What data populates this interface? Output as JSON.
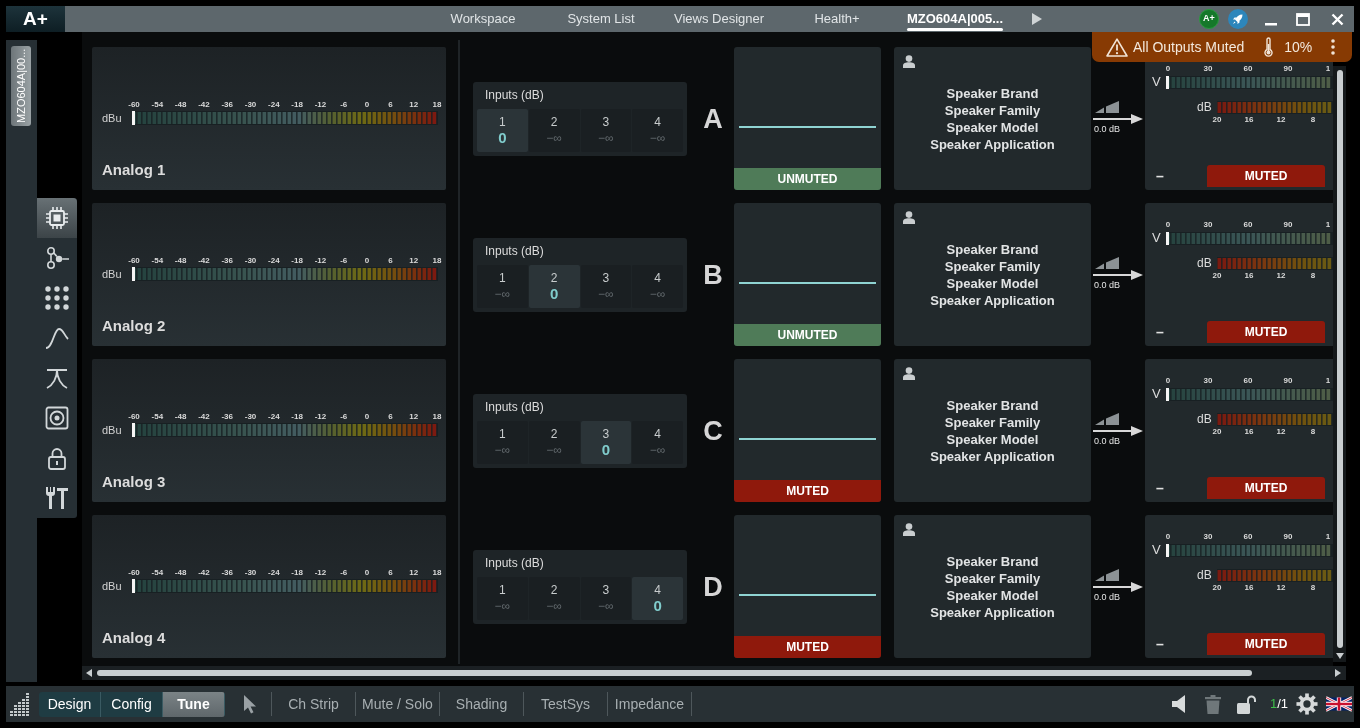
{
  "title_bar": {
    "logo": "A+",
    "tabs": [
      {
        "label": "Workspace",
        "selected": false
      },
      {
        "label": "System List",
        "selected": false
      },
      {
        "label": "Views Designer",
        "selected": false
      },
      {
        "label": "Health+",
        "selected": false
      },
      {
        "label": "MZO604A|005...",
        "selected": true
      }
    ],
    "badge": "A+"
  },
  "alert": {
    "message": "All Outputs Muted",
    "temperature": "10%"
  },
  "device_tab": "MZO604A|00...",
  "tool_rail": [
    {
      "kind": "chip",
      "selected": true
    },
    {
      "kind": "routing",
      "selected": false
    },
    {
      "kind": "matrix",
      "selected": false
    },
    {
      "kind": "filter",
      "selected": false
    },
    {
      "kind": "crossover",
      "selected": false
    },
    {
      "kind": "speaker",
      "selected": false
    },
    {
      "kind": "lock",
      "selected": false
    },
    {
      "kind": "tools",
      "selected": false
    }
  ],
  "channels": [
    {
      "input_name": "Analog 1",
      "meter": {
        "unit": "dBu",
        "scale": [
          "-60",
          "-54",
          "-48",
          "-42",
          "-36",
          "-30",
          "-24",
          "-18",
          "-12",
          "-6",
          "0",
          "6",
          "12",
          "18"
        ],
        "level": 0
      },
      "inputs_title": "Inputs (dB)",
      "inputs": [
        {
          "number": "1",
          "value": "0",
          "selected": true
        },
        {
          "number": "2",
          "value": "−∞",
          "selected": false
        },
        {
          "number": "3",
          "value": "−∞",
          "selected": false
        },
        {
          "number": "4",
          "value": "−∞",
          "selected": false
        }
      ],
      "letter": "A",
      "mute": {
        "label": "UNMUTED",
        "muted": false
      },
      "speaker": [
        "Speaker Brand",
        "Speaker Family",
        "Speaker Model",
        "Speaker Application"
      ],
      "gain": "0.0 dB",
      "output": {
        "voltage_unit": "V",
        "voltage_scale": [
          "0",
          "30",
          "60",
          "90",
          "1"
        ],
        "level": 0,
        "limiter_unit": "dB",
        "limiter_scale": [
          "20",
          "16",
          "12",
          "8"
        ],
        "dash": "–",
        "mute": {
          "label": "MUTED",
          "muted": true
        }
      }
    },
    {
      "input_name": "Analog 2",
      "meter": {
        "unit": "dBu",
        "scale": [
          "-60",
          "-54",
          "-48",
          "-42",
          "-36",
          "-30",
          "-24",
          "-18",
          "-12",
          "-6",
          "0",
          "6",
          "12",
          "18"
        ],
        "level": 0
      },
      "inputs_title": "Inputs (dB)",
      "inputs": [
        {
          "number": "1",
          "value": "−∞",
          "selected": false
        },
        {
          "number": "2",
          "value": "0",
          "selected": true
        },
        {
          "number": "3",
          "value": "−∞",
          "selected": false
        },
        {
          "number": "4",
          "value": "−∞",
          "selected": false
        }
      ],
      "letter": "B",
      "mute": {
        "label": "UNMUTED",
        "muted": false
      },
      "speaker": [
        "Speaker Brand",
        "Speaker Family",
        "Speaker Model",
        "Speaker Application"
      ],
      "gain": "0.0 dB",
      "output": {
        "voltage_unit": "V",
        "voltage_scale": [
          "0",
          "30",
          "60",
          "90",
          "1"
        ],
        "level": 0,
        "limiter_unit": "dB",
        "limiter_scale": [
          "20",
          "16",
          "12",
          "8"
        ],
        "dash": "–",
        "mute": {
          "label": "MUTED",
          "muted": true
        }
      }
    },
    {
      "input_name": "Analog 3",
      "meter": {
        "unit": "dBu",
        "scale": [
          "-60",
          "-54",
          "-48",
          "-42",
          "-36",
          "-30",
          "-24",
          "-18",
          "-12",
          "-6",
          "0",
          "6",
          "12",
          "18"
        ],
        "level": 0
      },
      "inputs_title": "Inputs (dB)",
      "inputs": [
        {
          "number": "1",
          "value": "−∞",
          "selected": false
        },
        {
          "number": "2",
          "value": "−∞",
          "selected": false
        },
        {
          "number": "3",
          "value": "0",
          "selected": true
        },
        {
          "number": "4",
          "value": "−∞",
          "selected": false
        }
      ],
      "letter": "C",
      "mute": {
        "label": "MUTED",
        "muted": true
      },
      "speaker": [
        "Speaker Brand",
        "Speaker Family",
        "Speaker Model",
        "Speaker Application"
      ],
      "gain": "0.0 dB",
      "output": {
        "voltage_unit": "V",
        "voltage_scale": [
          "0",
          "30",
          "60",
          "90",
          "1"
        ],
        "level": 0,
        "limiter_unit": "dB",
        "limiter_scale": [
          "20",
          "16",
          "12",
          "8"
        ],
        "dash": "–",
        "mute": {
          "label": "MUTED",
          "muted": true
        }
      }
    },
    {
      "input_name": "Analog 4",
      "meter": {
        "unit": "dBu",
        "scale": [
          "-60",
          "-54",
          "-48",
          "-42",
          "-36",
          "-30",
          "-24",
          "-18",
          "-12",
          "-6",
          "0",
          "6",
          "12",
          "18"
        ],
        "level": 0
      },
      "inputs_title": "Inputs (dB)",
      "inputs": [
        {
          "number": "1",
          "value": "−∞",
          "selected": false
        },
        {
          "number": "2",
          "value": "−∞",
          "selected": false
        },
        {
          "number": "3",
          "value": "−∞",
          "selected": false
        },
        {
          "number": "4",
          "value": "0",
          "selected": true
        }
      ],
      "letter": "D",
      "mute": {
        "label": "MUTED",
        "muted": true
      },
      "speaker": [
        "Speaker Brand",
        "Speaker Family",
        "Speaker Model",
        "Speaker Application"
      ],
      "gain": "0.0 dB",
      "output": {
        "voltage_unit": "V",
        "voltage_scale": [
          "0",
          "30",
          "60",
          "90",
          "1"
        ],
        "level": 0,
        "limiter_unit": "dB",
        "limiter_scale": [
          "20",
          "16",
          "12",
          "8"
        ],
        "dash": "–",
        "mute": {
          "label": "MUTED",
          "muted": true
        }
      }
    }
  ],
  "bottom_bar": {
    "modes": [
      {
        "label": "Design",
        "selected": false
      },
      {
        "label": "Config",
        "selected": false
      },
      {
        "label": "Tune",
        "selected": true
      }
    ],
    "tools": [
      "Ch Strip",
      "Mute / Solo",
      "Shading",
      "TestSys",
      "Impedance"
    ],
    "page": {
      "current": "1",
      "total": "/1"
    }
  }
}
